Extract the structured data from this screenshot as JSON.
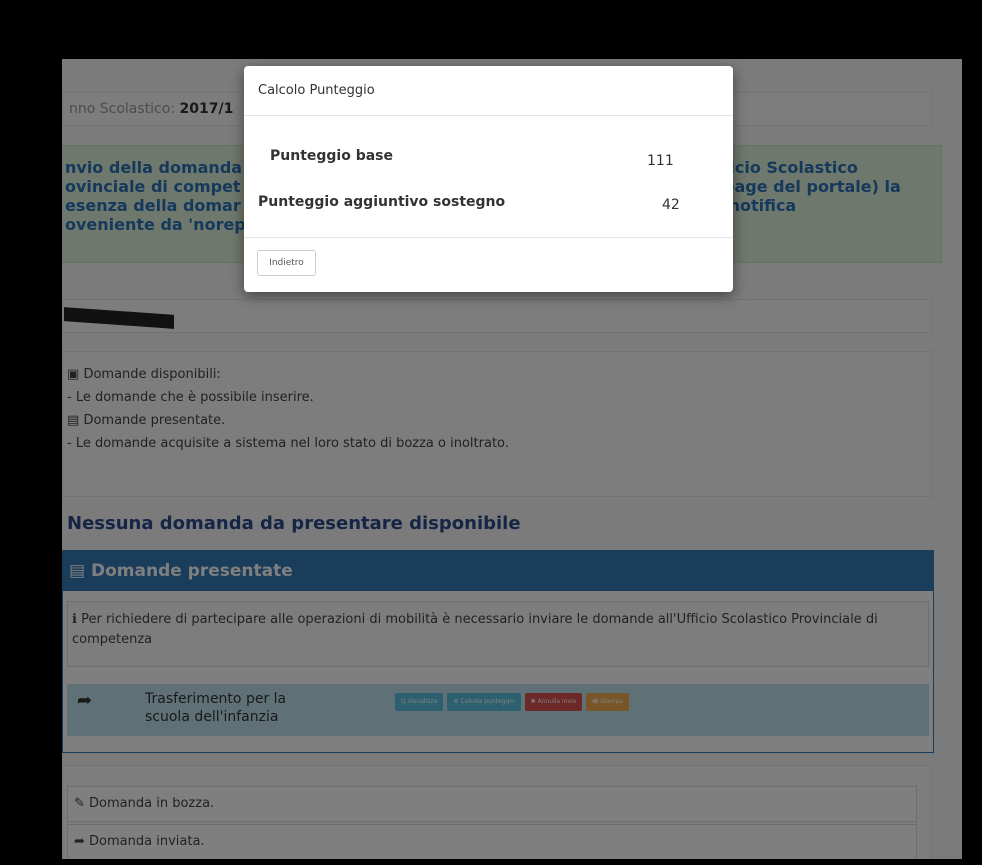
{
  "background_page": {
    "year_label": "nno Scolastico: ",
    "year_value": "2017/1",
    "alert_left": "nvio della domanda\novinciale di compet\nesenza della domar\noveniente da 'norep",
    "alert_right": "ficio Scolastico\npage del portale) la\n notifica",
    "legend": {
      "available_title": "Domande disponibili:",
      "available_desc": "- Le domande che è possibile inserire.",
      "submitted_title": "Domande presentate.",
      "submitted_desc": "- Le domande acquisite a sistema nel loro stato di bozza o inoltrato."
    },
    "no_domande": "Nessuna domanda da presentare disponibile",
    "panel_title": "Domande presentate",
    "info_text": "Per richiedere di partecipare alle operazioni di mobilità è necessario inviare le domande all'Ufficio Scolastico Provinciale di competenza",
    "row_label": "Trasferimento per la scuola dell'infanzia",
    "row_buttons": [
      {
        "label": "Q Visualizza",
        "color": "#5bc0de"
      },
      {
        "label": "⚙ Calcola punteggio",
        "color": "#5bc0de"
      },
      {
        "label": "✖ Annulla invio",
        "color": "#d9534f"
      },
      {
        "label": "🖶 Stampa",
        "color": "#f0ad4e"
      }
    ],
    "legend2": {
      "draft": "Domanda in bozza.",
      "sent": "Domanda inviata."
    }
  },
  "modal": {
    "title": "Calcolo Punteggio",
    "scores": [
      {
        "label": "Punteggio base",
        "value": "111"
      },
      {
        "label": "Punteggio aggiuntivo sostegno",
        "value": "42"
      }
    ],
    "back_label": "Indietro"
  }
}
